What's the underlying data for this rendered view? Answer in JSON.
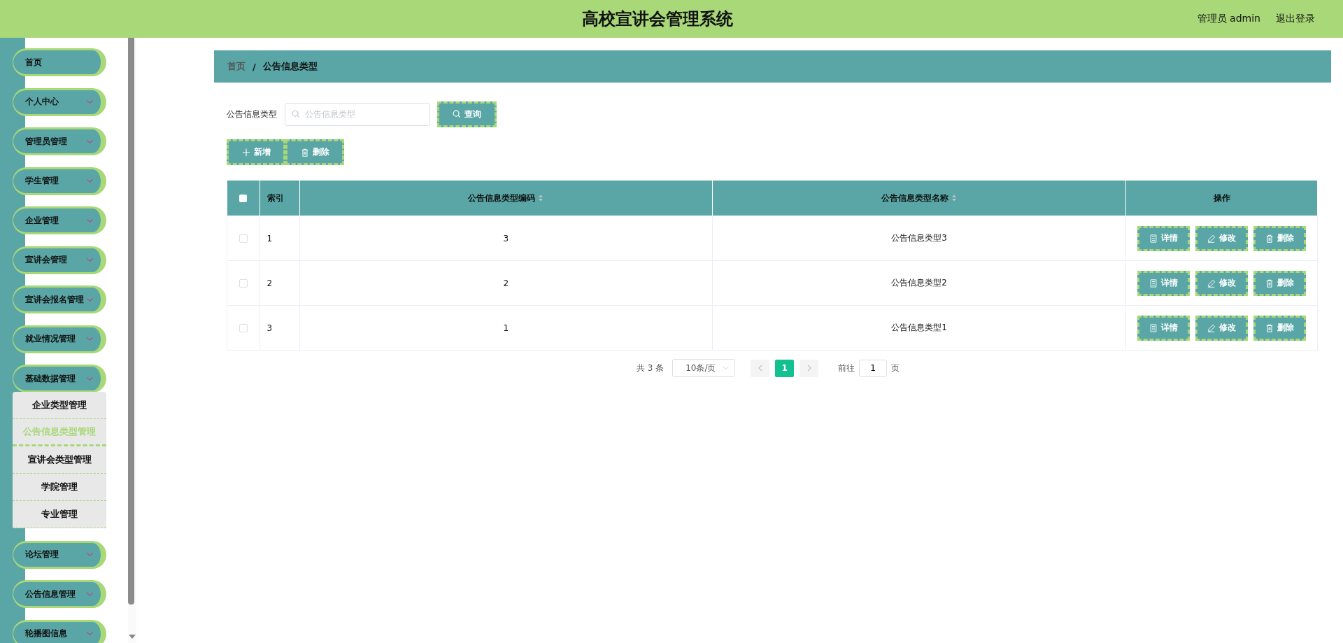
{
  "header": {
    "title": "高校宣讲会管理系统",
    "user": "管理员 admin",
    "logout": "退出登录"
  },
  "sidebar": {
    "items": [
      {
        "label": "首页",
        "kind": "link"
      },
      {
        "label": "个人中心",
        "kind": "submenu"
      },
      {
        "label": "管理员管理",
        "kind": "submenu"
      },
      {
        "label": "学生管理",
        "kind": "submenu"
      },
      {
        "label": "企业管理",
        "kind": "submenu"
      },
      {
        "label": "宣讲会管理",
        "kind": "submenu"
      },
      {
        "label": "宣讲会报名管理",
        "kind": "submenu"
      },
      {
        "label": "就业情况管理",
        "kind": "submenu"
      },
      {
        "label": "基础数据管理",
        "kind": "submenu",
        "children": [
          {
            "label": "企业类型管理",
            "selected": false
          },
          {
            "label": "公告信息类型管理",
            "selected": true
          },
          {
            "label": "宣讲会类型管理",
            "selected": false
          },
          {
            "label": "学院管理",
            "selected": false
          },
          {
            "label": "专业管理",
            "selected": false
          }
        ]
      },
      {
        "label": "论坛管理",
        "kind": "submenu"
      },
      {
        "label": "公告信息管理",
        "kind": "submenu"
      },
      {
        "label": "轮播图信息",
        "kind": "submenu"
      }
    ]
  },
  "breadcrumb": {
    "home": "首页",
    "separator": "/",
    "current": "公告信息类型"
  },
  "search": {
    "label": "公告信息类型",
    "placeholder": "公告信息类型",
    "button": "查询"
  },
  "toolbar": [
    {
      "kind": "add",
      "label": "新增"
    },
    {
      "kind": "delete",
      "label": "删除"
    }
  ],
  "table": {
    "select_all_checked": false,
    "columns": [
      {
        "kind": "check"
      },
      {
        "kind": "index",
        "label": "索引"
      },
      {
        "kind": "sort",
        "label": "公告信息类型编码"
      },
      {
        "kind": "sort",
        "label": "公告信息类型名称"
      },
      {
        "kind": "actions",
        "label": "操作"
      }
    ],
    "rows": [
      {
        "checked": false,
        "index": "1",
        "code": "3",
        "name": "公告信息类型3",
        "actions": [
          {
            "kind": "detail",
            "label": "详情"
          },
          {
            "kind": "edit",
            "label": "修改"
          },
          {
            "kind": "delete",
            "label": "删除"
          }
        ]
      },
      {
        "checked": false,
        "index": "2",
        "code": "2",
        "name": "公告信息类型2",
        "actions": [
          {
            "kind": "detail",
            "label": "详情"
          },
          {
            "kind": "edit",
            "label": "修改"
          },
          {
            "kind": "delete",
            "label": "删除"
          }
        ]
      },
      {
        "checked": false,
        "index": "3",
        "code": "1",
        "name": "公告信息类型1",
        "actions": [
          {
            "kind": "detail",
            "label": "详情"
          },
          {
            "kind": "edit",
            "label": "修改"
          },
          {
            "kind": "delete",
            "label": "删除"
          }
        ]
      }
    ]
  },
  "pagination": {
    "total": "共 3 条",
    "page_size": "10条/页",
    "pages": [
      {
        "label": "1",
        "selected": true
      }
    ],
    "jump_label": "前往",
    "jump_value": "1",
    "jump_suffix": "页"
  }
}
